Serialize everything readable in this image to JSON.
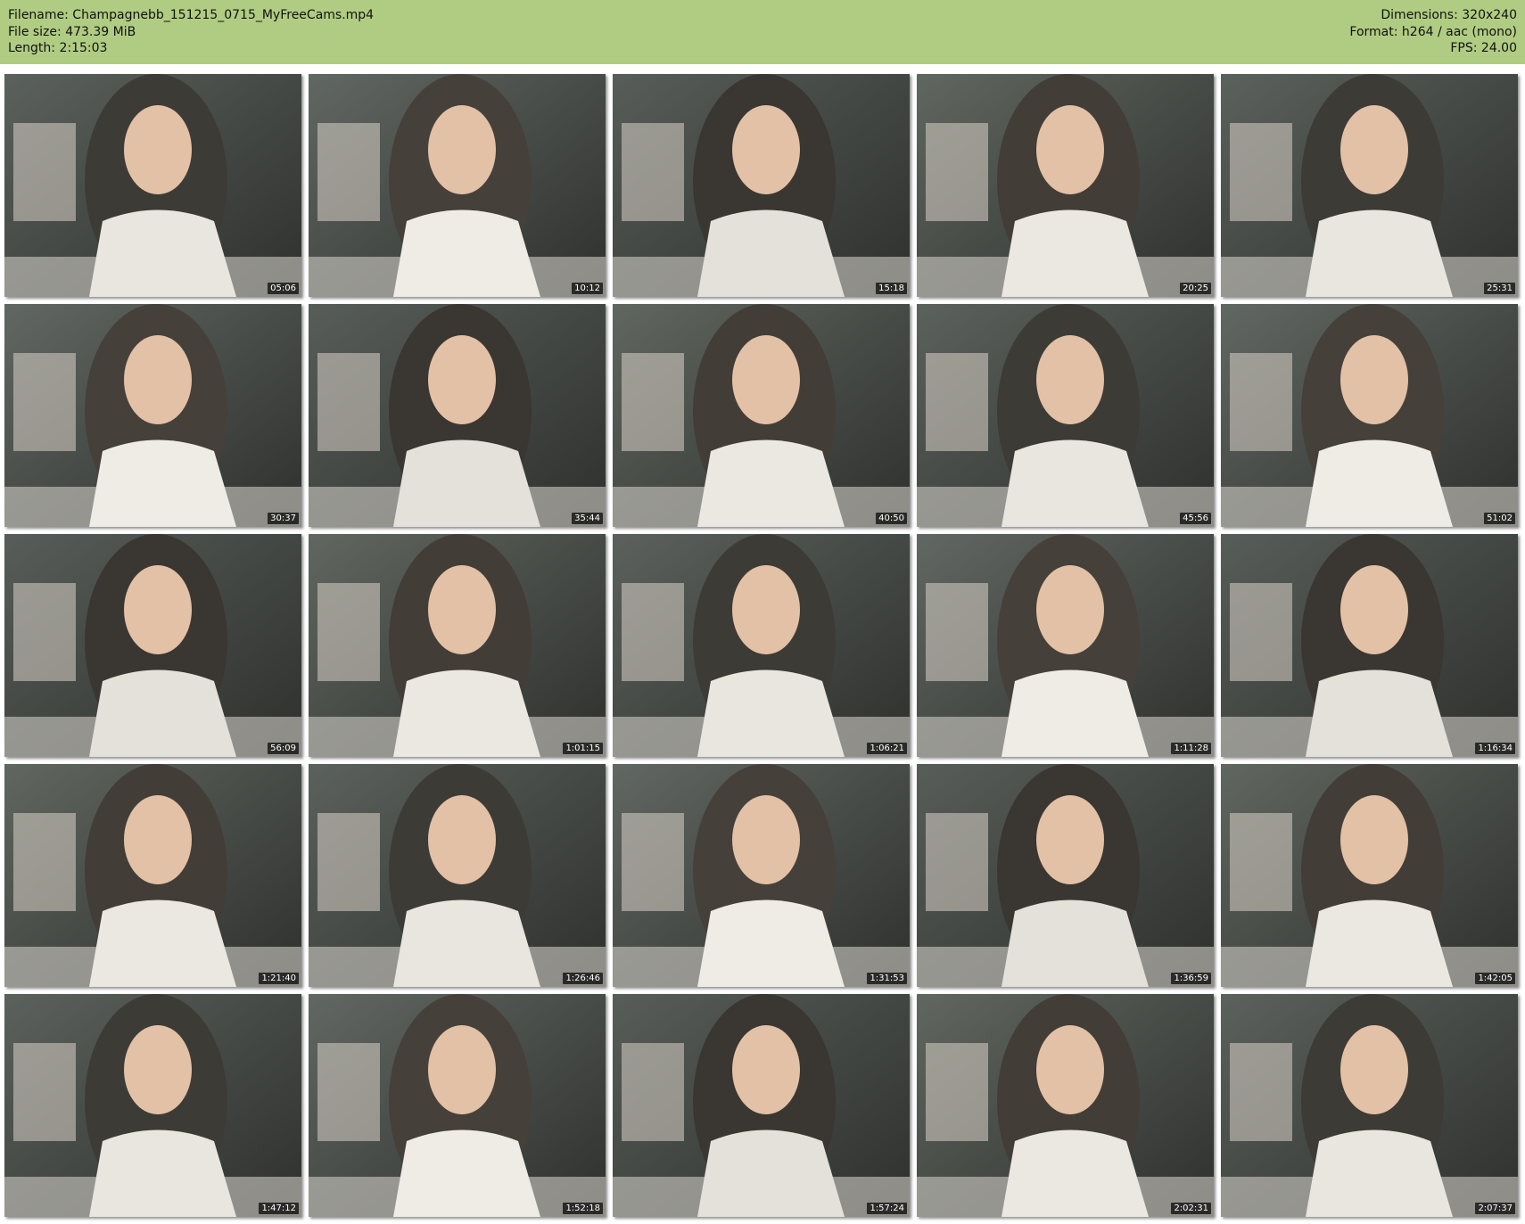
{
  "header": {
    "filename": "Filename: Champagnebb_151215_0715_MyFreeCams.mp4",
    "filesize": "File size: 473.39 MiB",
    "length": "Length: 2:15:03",
    "dimensions": "Dimensions: 320x240",
    "format": "Format: h264 / aac (mono)",
    "fps": "FPS: 24.00"
  },
  "colors": {
    "header_background": "#b0cc82"
  },
  "thumbnails": [
    {
      "timestamp": "05:06",
      "icon": "video-frame-image"
    },
    {
      "timestamp": "10:12",
      "icon": "video-frame-image"
    },
    {
      "timestamp": "15:18",
      "icon": "video-frame-image"
    },
    {
      "timestamp": "20:25",
      "icon": "video-frame-image"
    },
    {
      "timestamp": "25:31",
      "icon": "video-frame-image"
    },
    {
      "timestamp": "30:37",
      "icon": "video-frame-image"
    },
    {
      "timestamp": "35:44",
      "icon": "video-frame-image"
    },
    {
      "timestamp": "40:50",
      "icon": "video-frame-image"
    },
    {
      "timestamp": "45:56",
      "icon": "video-frame-image"
    },
    {
      "timestamp": "51:02",
      "icon": "video-frame-image"
    },
    {
      "timestamp": "56:09",
      "icon": "video-frame-image"
    },
    {
      "timestamp": "1:01:15",
      "icon": "video-frame-image"
    },
    {
      "timestamp": "1:06:21",
      "icon": "video-frame-image"
    },
    {
      "timestamp": "1:11:28",
      "icon": "video-frame-image"
    },
    {
      "timestamp": "1:16:34",
      "icon": "video-frame-image"
    },
    {
      "timestamp": "1:21:40",
      "icon": "video-frame-image"
    },
    {
      "timestamp": "1:26:46",
      "icon": "video-frame-image"
    },
    {
      "timestamp": "1:31:53",
      "icon": "video-frame-image"
    },
    {
      "timestamp": "1:36:59",
      "icon": "video-frame-image"
    },
    {
      "timestamp": "1:42:05",
      "icon": "video-frame-image"
    },
    {
      "timestamp": "1:47:12",
      "icon": "video-frame-image"
    },
    {
      "timestamp": "1:52:18",
      "icon": "video-frame-image"
    },
    {
      "timestamp": "1:57:24",
      "icon": "video-frame-image"
    },
    {
      "timestamp": "2:02:31",
      "icon": "video-frame-image"
    },
    {
      "timestamp": "2:07:37",
      "icon": "video-frame-image"
    }
  ]
}
